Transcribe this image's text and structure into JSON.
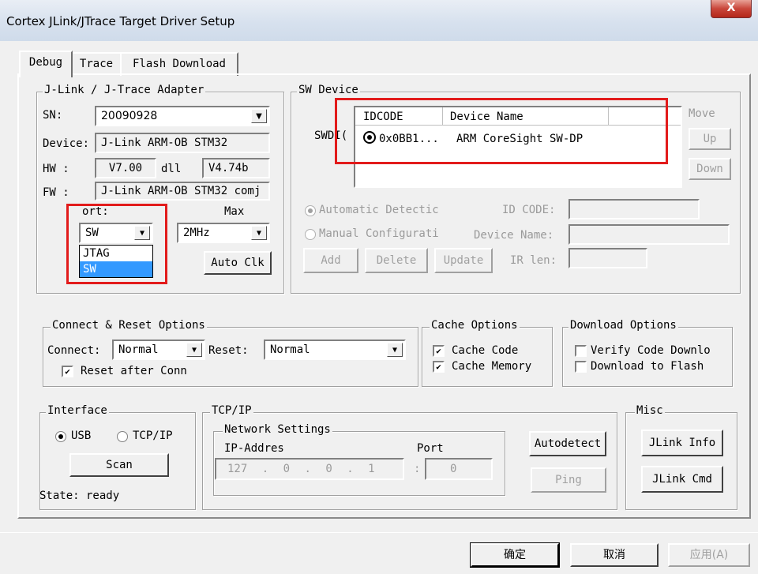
{
  "window": {
    "title": "Cortex JLink/JTrace Target Driver Setup",
    "close_label": "X"
  },
  "tabs": [
    {
      "label": "Debug",
      "active": true
    },
    {
      "label": "Trace",
      "active": false
    },
    {
      "label": "Flash Download",
      "active": false
    }
  ],
  "adapter": {
    "legend": "J-Link / J-Trace Adapter",
    "sn_label": "SN:",
    "sn_value": "20090928",
    "device_label": "Device:",
    "device_value": "J-Link ARM-OB STM32",
    "hw_label": "HW :",
    "hw_value": "V7.00",
    "dll_label": "dll",
    "dll_value": "V4.74b",
    "fw_label": "FW :",
    "fw_value": "J-Link ARM-OB STM32 comj",
    "port_label": "ort:",
    "port_value": "SW",
    "port_options": [
      "JTAG",
      "SW"
    ],
    "max_label": "Max",
    "max_value": "2MHz",
    "auto_clk_label": "Auto Clk"
  },
  "sw_device": {
    "legend": "SW Device",
    "swdi_label": "SWDI(",
    "columns": [
      "IDCODE",
      "Device Name"
    ],
    "row": {
      "idcode": "0x0BB1...",
      "device_name": "ARM CoreSight SW-DP"
    },
    "move_label": "Move",
    "up_label": "Up",
    "down_label": "Down",
    "auto_detect_label": "Automatic Detectic",
    "manual_config_label": "Manual Configurati",
    "id_code_label": "ID CODE:",
    "device_name_label": "Device Name:",
    "add_label": "Add",
    "delete_label": "Delete",
    "update_label": "Update",
    "ir_len_label": "IR len:"
  },
  "connect_reset": {
    "legend": "Connect & Reset Options",
    "connect_label": "Connect:",
    "connect_value": "Normal",
    "reset_label": "Reset:",
    "reset_value": "Normal",
    "reset_after_label": "Reset after Conn",
    "reset_after_checked": true
  },
  "cache": {
    "legend": "Cache Options",
    "cache_code_label": "Cache Code",
    "cache_code_checked": true,
    "cache_memory_label": "Cache Memory",
    "cache_memory_checked": true
  },
  "download": {
    "legend": "Download Options",
    "verify_label": "Verify Code Downlo",
    "verify_checked": false,
    "to_flash_label": "Download to Flash",
    "to_flash_checked": false
  },
  "interface": {
    "legend": "Interface",
    "usb_label": "USB",
    "tcpip_label": "TCP/IP",
    "selected": "USB",
    "scan_label": "Scan",
    "state_text": "State: ready"
  },
  "tcpip": {
    "legend": "TCP/IP",
    "network_legend": "Network Settings",
    "ip_label": "IP-Addres",
    "ip_octets": [
      "127",
      "0",
      "0",
      "1"
    ],
    "port_label": "Port",
    "port_value": "0",
    "autodetect_label": "Autodetect",
    "ping_label": "Ping"
  },
  "misc": {
    "legend": "Misc",
    "jlink_info_label": "JLink Info",
    "jlink_cmd_label": "JLink Cmd"
  },
  "footer": {
    "ok_label": "确定",
    "cancel_label": "取消",
    "apply_label": "应用(A)"
  },
  "colors": {
    "highlight_box": "#e21b1b",
    "selection": "#3399ff",
    "title_gradient": "#d7e1ee",
    "close_button": "#c9463a"
  }
}
